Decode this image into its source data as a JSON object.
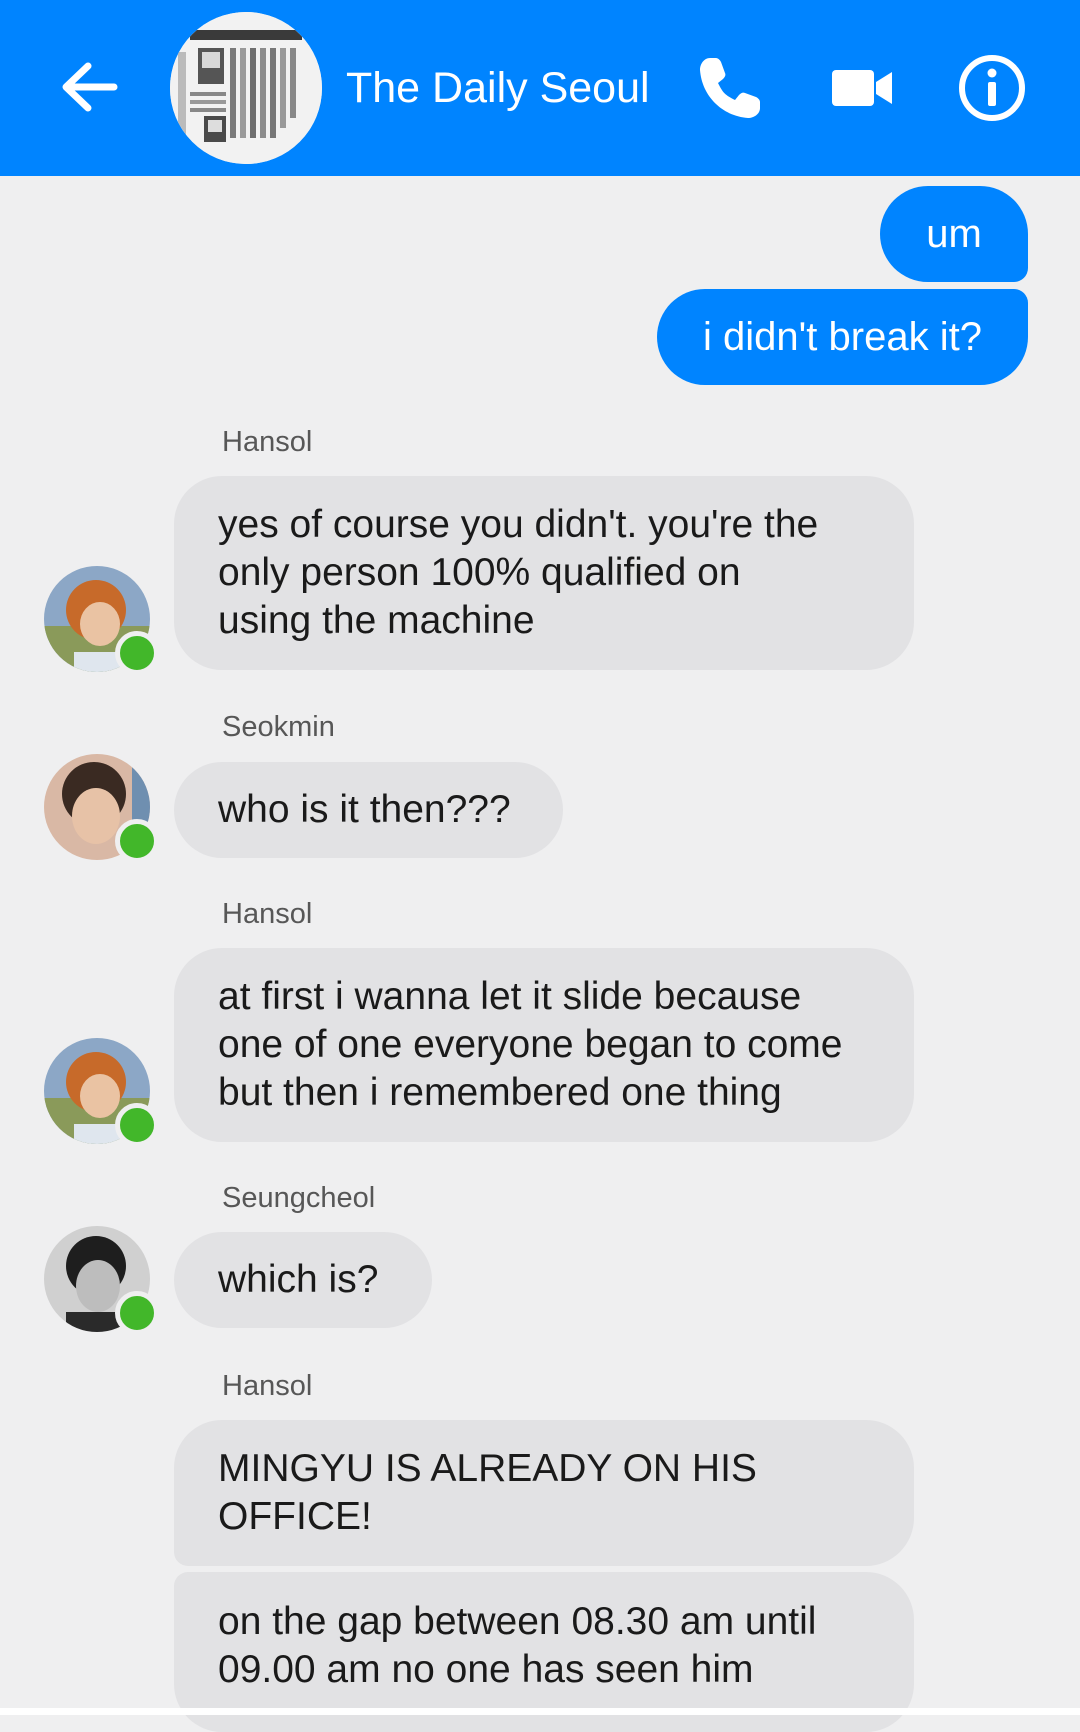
{
  "header": {
    "title": "The Daily Seoul",
    "back_icon": "back-arrow-icon",
    "phone_icon": "phone-icon",
    "video_icon": "video-camera-icon",
    "info_icon": "info-icon",
    "background_color": "#0084ff"
  },
  "messages": {
    "outgoing": [
      {
        "text": "um"
      },
      {
        "text": "i didn't break it?"
      }
    ],
    "incoming": [
      {
        "sender": "Hansol",
        "lines": [
          "yes of course you didn't. you're the",
          "only person 100% qualified on",
          "using the machine"
        ]
      },
      {
        "sender": "Seokmin",
        "lines": [
          "who is it then???"
        ]
      },
      {
        "sender": "Hansol",
        "lines": [
          "at first i wanna let it slide because",
          "one of one everyone began to come",
          "but then i remembered one thing"
        ]
      },
      {
        "sender": "Seungcheol",
        "lines": [
          "which is?"
        ]
      },
      {
        "sender": "Hansol",
        "lines": [
          "MINGYU IS ALREADY ON HIS",
          "OFFICE!"
        ]
      },
      {
        "sender": "",
        "lines": [
          "on the gap between 08.30 am until",
          "09.00 am no one has seen him"
        ]
      }
    ]
  },
  "colors": {
    "outgoing_bubble": "#0084ff",
    "incoming_bubble": "#e2e2e4",
    "online_indicator": "#42b72a",
    "chat_background": "#efeff0"
  }
}
